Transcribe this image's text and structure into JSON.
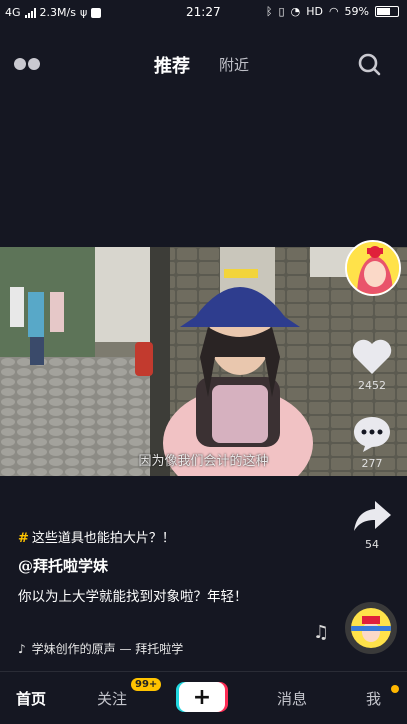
{
  "status_bar": {
    "network": "4G",
    "speed": "2.3M/s",
    "time": "21:27",
    "hd": "HD",
    "battery": "59%"
  },
  "top_nav": {
    "tab_recommend": "推荐",
    "tab_nearby": "附近"
  },
  "video": {
    "subtitle": "因为像我们会计的这种"
  },
  "rail": {
    "likes": "2452",
    "comments": "277",
    "shares": "54"
  },
  "caption": {
    "topic": "这些道具也能拍大片？！",
    "author": "@拜托啦学妹",
    "description": "你以为上大学就能找到对象啦？年轻！",
    "music": "学妹创作的原声 — 拜托啦学"
  },
  "bottom_nav": {
    "home": "首页",
    "follow": "关注",
    "follow_badge": "99+",
    "plus": "+",
    "messages": "消息",
    "me": "我"
  },
  "colors": {
    "background": "#151722",
    "accent_yellow": "#ffc400",
    "cyan": "#21d7e0",
    "red": "#fe2c55"
  }
}
